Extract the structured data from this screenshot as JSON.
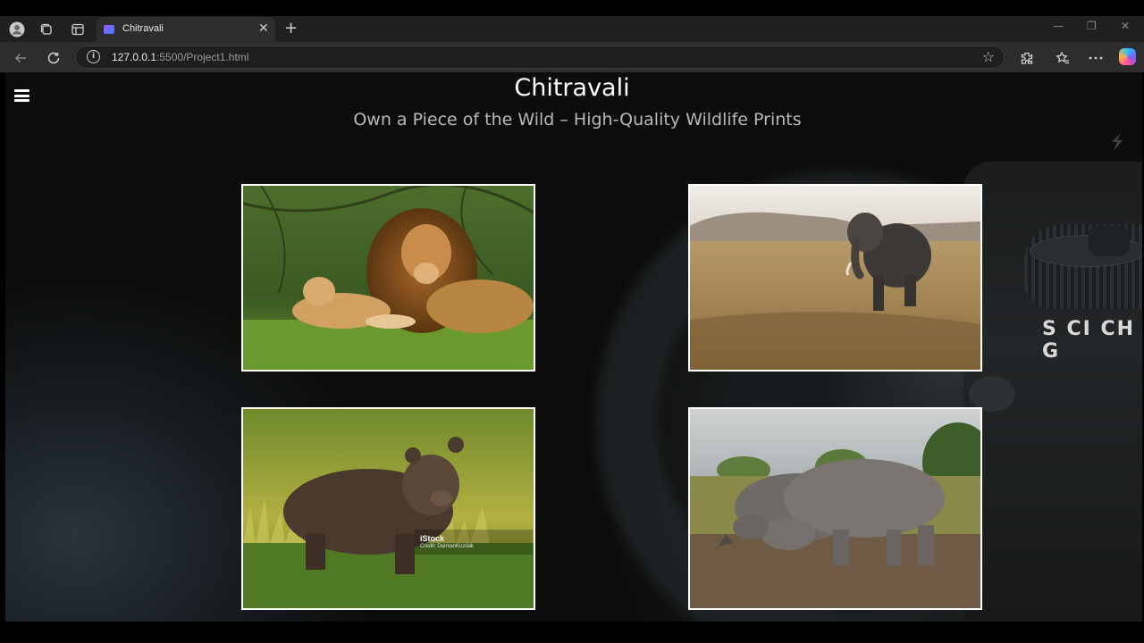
{
  "browser": {
    "tab_title": "Chitravali",
    "tab_close": "✕",
    "new_tab": "+",
    "url_host": "127.0.0.1",
    "url_rest": ":5500/Project1.html",
    "window_controls": {
      "minimize": "—",
      "restore": "❐",
      "close": "✕"
    }
  },
  "page": {
    "title": "Chitravali",
    "subtitle": "Own a Piece of the Wild – High-Quality Wildlife Prints",
    "camera_dial_text": "S CI CH G",
    "gallery": [
      {
        "name": "lion-photo",
        "subject": "Lion and cub"
      },
      {
        "name": "elephant-photo",
        "subject": "Elephant"
      },
      {
        "name": "bear-photo",
        "subject": "Brown bear",
        "watermark": "iStock",
        "credit": "Credit: DamianKuzdak"
      },
      {
        "name": "rhino-photo",
        "subject": "Rhinos"
      }
    ]
  },
  "colors": {
    "page_bg": "#0b0c0b",
    "title": "#ffffff",
    "subtitle": "#b8b8b8",
    "photo_border": "#ffffff"
  },
  "icons": [
    "profile-icon",
    "workspaces-icon",
    "tab-actions-icon",
    "back-icon",
    "refresh-icon",
    "info-icon",
    "favorite-star-icon",
    "extensions-icon",
    "favorites-icon",
    "more-icon",
    "copilot-icon",
    "hamburger-menu-icon"
  ]
}
